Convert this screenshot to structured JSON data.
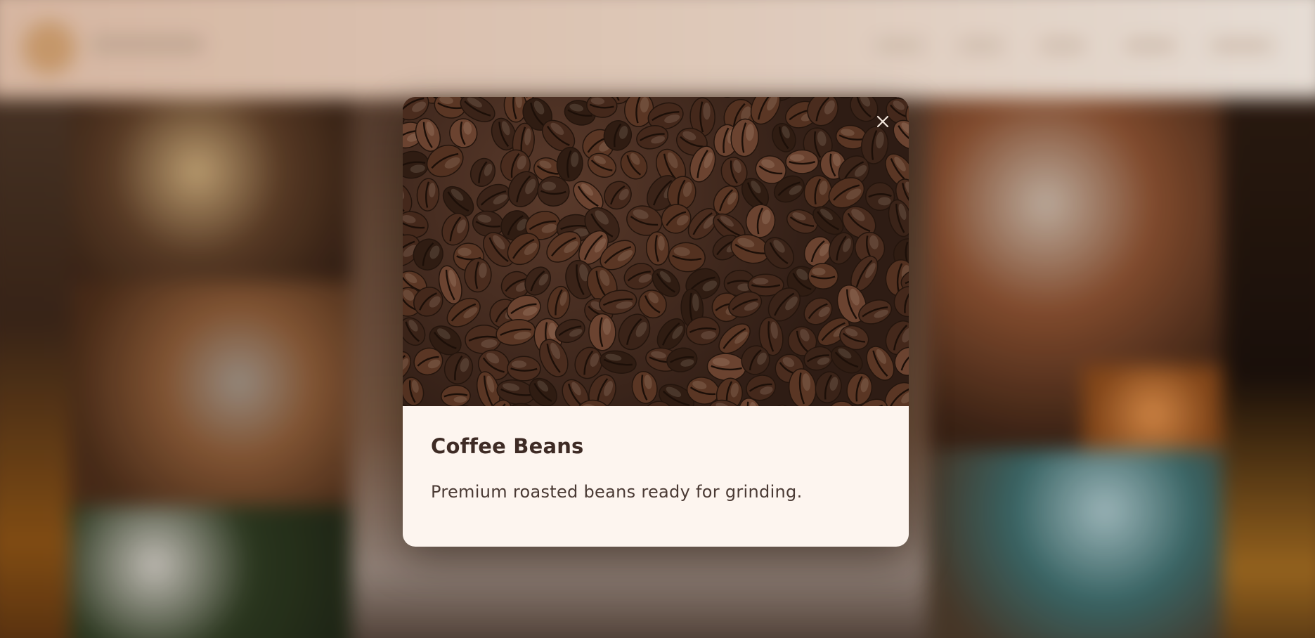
{
  "modal": {
    "title": "Coffee Beans",
    "description": "Premium roasted beans ready for grinding.",
    "image_icon": "coffee-beans-photo",
    "close_icon": "close-icon",
    "close_symbol": "×"
  },
  "colors": {
    "modal_background": "#fdf5ef",
    "title": "#3e2b25",
    "description": "#4a3a34",
    "header_background": "#efd9c8",
    "logo_accent": "#d4a372"
  }
}
